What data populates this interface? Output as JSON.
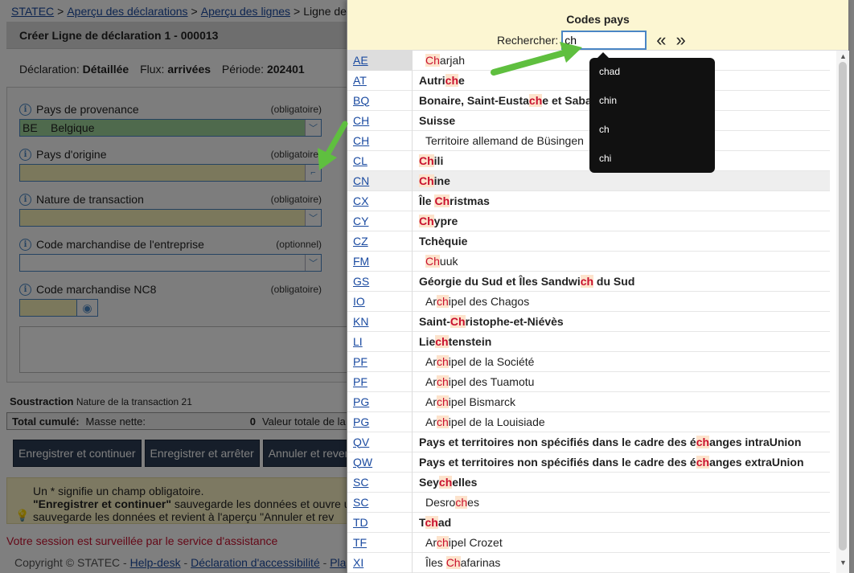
{
  "breadcrumb": {
    "items": [
      "STATEC",
      "Aperçu des déclarations",
      "Aperçu des lignes",
      "Ligne de"
    ],
    "separator": ">"
  },
  "form": {
    "title": "Créer Ligne de déclaration 1 - 000013",
    "meta": {
      "declaration_label": "Déclaration:",
      "declaration_value": "Détaillée",
      "flux_label": "Flux:",
      "flux_value": "arrivées",
      "periode_label": "Période:",
      "periode_value": "202401"
    },
    "fields": [
      {
        "label": "Pays de provenance",
        "req": "(obligatoire)",
        "code": "BE",
        "name": "Belgique"
      },
      {
        "label": "Pays d'origine",
        "req": "(obligatoire)",
        "code": "",
        "name": ""
      },
      {
        "label": "Nature de transaction",
        "req": "(obligatoire)",
        "code": "",
        "name": ""
      },
      {
        "label": "Code marchandise de l'entreprise",
        "req": "(optionnel)",
        "code": "",
        "name": ""
      },
      {
        "label": "Code marchandise NC8",
        "req": "(obligatoire)"
      }
    ],
    "soustraction_label": "Soustraction",
    "soustraction_text": "Nature de la transaction 21",
    "total_label": "Total cumulé:",
    "masse_label": "Masse nette:",
    "masse_value": "0",
    "valeur_label": "Valeur totale de la t",
    "buttons": [
      "Enregistrer et continuer",
      "Enregistrer et arrêter",
      "Annuler et reven"
    ],
    "note_line1": "Un * signifie un champ obligatoire.",
    "note_line2_bold": "\"Enregistrer et continuer\"",
    "note_line2_rest": " sauvegarde les données et ouvre u",
    "note_line3": "sauvegarde les données et revient à l'aperçu \"Annuler et rev",
    "session": "Votre session est surveillée par le service d'assistance",
    "footer": {
      "copyright": "Copyright © STATEC -",
      "helpdesk": "Help-desk",
      "sep": "-",
      "accessibility": "Déclaration d'accessibilité",
      "sep2": "-",
      "plan": "Pla"
    }
  },
  "popup": {
    "title": "Codes pays",
    "search_label": "Rechercher:",
    "search_value": "ch",
    "prev": "«",
    "next": "»",
    "suggestions": [
      "chad",
      "chin",
      "ch",
      "chi"
    ],
    "rows": [
      {
        "code": "AE",
        "parts": [
          "",
          "Ch",
          "arjah"
        ],
        "style": "i"
      },
      {
        "code": "AT",
        "parts": [
          "Autri",
          "ch",
          "e"
        ],
        "style": "b"
      },
      {
        "code": "BQ",
        "parts": [
          "Bonaire, Saint-Eusta",
          "ch",
          "e et Saba"
        ],
        "style": "b"
      },
      {
        "code": "CH",
        "parts": [
          "Suisse",
          "",
          ""
        ],
        "style": "b"
      },
      {
        "code": "CH",
        "parts": [
          "Territoire allemand de Büsingen",
          "",
          ""
        ],
        "style": "i"
      },
      {
        "code": "CL",
        "parts": [
          "",
          "Ch",
          "ili"
        ],
        "style": "b"
      },
      {
        "code": "CN",
        "parts": [
          "",
          "Ch",
          "ine"
        ],
        "style": "b"
      },
      {
        "code": "CX",
        "parts": [
          "Île ",
          "Ch",
          "ristmas"
        ],
        "style": "b"
      },
      {
        "code": "CY",
        "parts": [
          "",
          "Ch",
          "ypre"
        ],
        "style": "b"
      },
      {
        "code": "CZ",
        "parts": [
          "Tchèquie",
          "",
          ""
        ],
        "style": "b"
      },
      {
        "code": "FM",
        "parts": [
          "",
          "Ch",
          "uuk"
        ],
        "style": "i"
      },
      {
        "code": "GS",
        "parts": [
          "Géorgie du Sud et Îles Sandwi",
          "ch",
          " du Sud"
        ],
        "style": "b"
      },
      {
        "code": "IO",
        "parts": [
          "Ar",
          "ch",
          "ipel des Chagos"
        ],
        "style": "i"
      },
      {
        "code": "KN",
        "parts": [
          "Saint-",
          "Ch",
          "ristophe-et-Niévès"
        ],
        "style": "b"
      },
      {
        "code": "LI",
        "parts": [
          "Lie",
          "ch",
          "tenstein"
        ],
        "style": "b"
      },
      {
        "code": "PF",
        "parts": [
          "Ar",
          "ch",
          "ipel de la Société"
        ],
        "style": "i"
      },
      {
        "code": "PF",
        "parts": [
          "Ar",
          "ch",
          "ipel des Tuamotu"
        ],
        "style": "i"
      },
      {
        "code": "PG",
        "parts": [
          "Ar",
          "ch",
          "ipel Bismarck"
        ],
        "style": "i"
      },
      {
        "code": "PG",
        "parts": [
          "Ar",
          "ch",
          "ipel de la Louisiade"
        ],
        "style": "i"
      },
      {
        "code": "QV",
        "parts": [
          "Pays et territoires non spécifiés dans le cadre des é",
          "ch",
          "anges intraUnion"
        ],
        "style": "b"
      },
      {
        "code": "QW",
        "parts": [
          "Pays et territoires non spécifiés dans le cadre des é",
          "ch",
          "anges extraUnion"
        ],
        "style": "b"
      },
      {
        "code": "SC",
        "parts": [
          "Sey",
          "ch",
          "elles"
        ],
        "style": "b"
      },
      {
        "code": "SC",
        "parts": [
          "Desro",
          "ch",
          "es"
        ],
        "style": "i"
      },
      {
        "code": "TD",
        "parts": [
          "T",
          "ch",
          "ad"
        ],
        "style": "b"
      },
      {
        "code": "TF",
        "parts": [
          "Ar",
          "ch",
          "ipel Crozet"
        ],
        "style": "i"
      },
      {
        "code": "XI",
        "parts": [
          "Îles ",
          "Ch",
          "afarinas"
        ],
        "style": "i"
      }
    ]
  },
  "colors": {
    "accent": "#4a86c5",
    "button": "#2c3d55",
    "highlight": "#c8102e",
    "popup_header": "#fcf6d2",
    "arrow": "#5fbf3f"
  },
  "icons": {
    "info": "info-icon",
    "dropdown": "chevron-down-icon",
    "eye": "eye-icon",
    "bulb": "lightbulb-icon"
  }
}
